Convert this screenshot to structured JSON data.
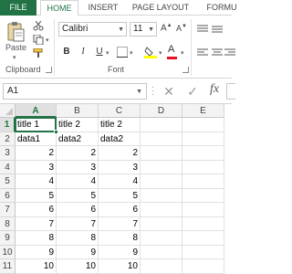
{
  "ribbon_tabs": [
    "FILE",
    "HOME",
    "INSERT",
    "PAGE LAYOUT",
    "FORMU"
  ],
  "clipboard": {
    "paste_label": "Paste",
    "group_label": "Clipboard"
  },
  "font": {
    "family": "Calibri",
    "size": "11",
    "group_label": "Font",
    "bold": "B",
    "italic": "I",
    "underline": "U"
  },
  "formula_bar": {
    "name_box": "A1",
    "fx_label": "fx",
    "cancel": "✕",
    "enter": "✓"
  },
  "grid": {
    "columns": [
      "A",
      "B",
      "C",
      "D",
      "E"
    ],
    "rows": [
      "1",
      "2",
      "3",
      "4",
      "5",
      "6",
      "7",
      "8",
      "9",
      "10",
      "11"
    ],
    "cells": [
      [
        "title 1",
        "title 2",
        "title 2",
        "",
        ""
      ],
      [
        "data1",
        "data2",
        "data2",
        "",
        ""
      ],
      [
        "2",
        "2",
        "2",
        "",
        ""
      ],
      [
        "3",
        "3",
        "3",
        "",
        ""
      ],
      [
        "4",
        "4",
        "4",
        "",
        ""
      ],
      [
        "5",
        "5",
        "5",
        "",
        ""
      ],
      [
        "6",
        "6",
        "6",
        "",
        ""
      ],
      [
        "7",
        "7",
        "7",
        "",
        ""
      ],
      [
        "8",
        "8",
        "8",
        "",
        ""
      ],
      [
        "9",
        "9",
        "9",
        "",
        ""
      ],
      [
        "10",
        "10",
        "10",
        "",
        ""
      ]
    ],
    "active_cell": "A1"
  },
  "colors": {
    "accent": "#217346",
    "fill_highlight": "#ffff00",
    "font_color": "#e81123"
  }
}
